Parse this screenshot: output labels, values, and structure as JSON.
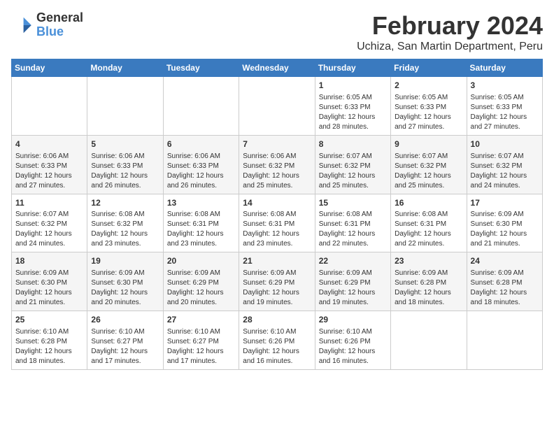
{
  "header": {
    "logo_line1": "General",
    "logo_line2": "Blue",
    "main_title": "February 2024",
    "subtitle": "Uchiza, San Martin Department, Peru"
  },
  "weekdays": [
    "Sunday",
    "Monday",
    "Tuesday",
    "Wednesday",
    "Thursday",
    "Friday",
    "Saturday"
  ],
  "weeks": [
    [
      {
        "day": "",
        "text": ""
      },
      {
        "day": "",
        "text": ""
      },
      {
        "day": "",
        "text": ""
      },
      {
        "day": "",
        "text": ""
      },
      {
        "day": "1",
        "text": "Sunrise: 6:05 AM\nSunset: 6:33 PM\nDaylight: 12 hours\nand 28 minutes."
      },
      {
        "day": "2",
        "text": "Sunrise: 6:05 AM\nSunset: 6:33 PM\nDaylight: 12 hours\nand 27 minutes."
      },
      {
        "day": "3",
        "text": "Sunrise: 6:05 AM\nSunset: 6:33 PM\nDaylight: 12 hours\nand 27 minutes."
      }
    ],
    [
      {
        "day": "4",
        "text": "Sunrise: 6:06 AM\nSunset: 6:33 PM\nDaylight: 12 hours\nand 27 minutes."
      },
      {
        "day": "5",
        "text": "Sunrise: 6:06 AM\nSunset: 6:33 PM\nDaylight: 12 hours\nand 26 minutes."
      },
      {
        "day": "6",
        "text": "Sunrise: 6:06 AM\nSunset: 6:33 PM\nDaylight: 12 hours\nand 26 minutes."
      },
      {
        "day": "7",
        "text": "Sunrise: 6:06 AM\nSunset: 6:32 PM\nDaylight: 12 hours\nand 25 minutes."
      },
      {
        "day": "8",
        "text": "Sunrise: 6:07 AM\nSunset: 6:32 PM\nDaylight: 12 hours\nand 25 minutes."
      },
      {
        "day": "9",
        "text": "Sunrise: 6:07 AM\nSunset: 6:32 PM\nDaylight: 12 hours\nand 25 minutes."
      },
      {
        "day": "10",
        "text": "Sunrise: 6:07 AM\nSunset: 6:32 PM\nDaylight: 12 hours\nand 24 minutes."
      }
    ],
    [
      {
        "day": "11",
        "text": "Sunrise: 6:07 AM\nSunset: 6:32 PM\nDaylight: 12 hours\nand 24 minutes."
      },
      {
        "day": "12",
        "text": "Sunrise: 6:08 AM\nSunset: 6:32 PM\nDaylight: 12 hours\nand 23 minutes."
      },
      {
        "day": "13",
        "text": "Sunrise: 6:08 AM\nSunset: 6:31 PM\nDaylight: 12 hours\nand 23 minutes."
      },
      {
        "day": "14",
        "text": "Sunrise: 6:08 AM\nSunset: 6:31 PM\nDaylight: 12 hours\nand 23 minutes."
      },
      {
        "day": "15",
        "text": "Sunrise: 6:08 AM\nSunset: 6:31 PM\nDaylight: 12 hours\nand 22 minutes."
      },
      {
        "day": "16",
        "text": "Sunrise: 6:08 AM\nSunset: 6:31 PM\nDaylight: 12 hours\nand 22 minutes."
      },
      {
        "day": "17",
        "text": "Sunrise: 6:09 AM\nSunset: 6:30 PM\nDaylight: 12 hours\nand 21 minutes."
      }
    ],
    [
      {
        "day": "18",
        "text": "Sunrise: 6:09 AM\nSunset: 6:30 PM\nDaylight: 12 hours\nand 21 minutes."
      },
      {
        "day": "19",
        "text": "Sunrise: 6:09 AM\nSunset: 6:30 PM\nDaylight: 12 hours\nand 20 minutes."
      },
      {
        "day": "20",
        "text": "Sunrise: 6:09 AM\nSunset: 6:29 PM\nDaylight: 12 hours\nand 20 minutes."
      },
      {
        "day": "21",
        "text": "Sunrise: 6:09 AM\nSunset: 6:29 PM\nDaylight: 12 hours\nand 19 minutes."
      },
      {
        "day": "22",
        "text": "Sunrise: 6:09 AM\nSunset: 6:29 PM\nDaylight: 12 hours\nand 19 minutes."
      },
      {
        "day": "23",
        "text": "Sunrise: 6:09 AM\nSunset: 6:28 PM\nDaylight: 12 hours\nand 18 minutes."
      },
      {
        "day": "24",
        "text": "Sunrise: 6:09 AM\nSunset: 6:28 PM\nDaylight: 12 hours\nand 18 minutes."
      }
    ],
    [
      {
        "day": "25",
        "text": "Sunrise: 6:10 AM\nSunset: 6:28 PM\nDaylight: 12 hours\nand 18 minutes."
      },
      {
        "day": "26",
        "text": "Sunrise: 6:10 AM\nSunset: 6:27 PM\nDaylight: 12 hours\nand 17 minutes."
      },
      {
        "day": "27",
        "text": "Sunrise: 6:10 AM\nSunset: 6:27 PM\nDaylight: 12 hours\nand 17 minutes."
      },
      {
        "day": "28",
        "text": "Sunrise: 6:10 AM\nSunset: 6:26 PM\nDaylight: 12 hours\nand 16 minutes."
      },
      {
        "day": "29",
        "text": "Sunrise: 6:10 AM\nSunset: 6:26 PM\nDaylight: 12 hours\nand 16 minutes."
      },
      {
        "day": "",
        "text": ""
      },
      {
        "day": "",
        "text": ""
      }
    ]
  ]
}
